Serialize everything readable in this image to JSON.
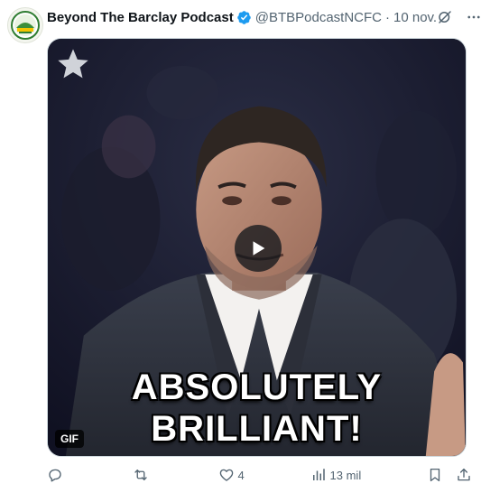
{
  "tweet": {
    "author_name": "Beyond The Barclay Podcast",
    "handle": "@BTBPodcastNCFC",
    "separator": "·",
    "date": "10 nov."
  },
  "media": {
    "caption_line1": "ABSOLUTELY",
    "caption_line2": "BRILLIANT!",
    "badge": "GIF"
  },
  "actions": {
    "replies": "",
    "reposts": "",
    "likes": "4",
    "views": "13 mil"
  },
  "icons": {
    "verified": "verified-badge-icon",
    "grok": "grok-icon",
    "more": "more-icon",
    "reply": "reply-icon",
    "repost": "repost-icon",
    "like": "heart-icon",
    "views": "views-icon",
    "bookmark": "bookmark-icon",
    "share": "share-icon"
  },
  "colors": {
    "verified": "#1d9bf0",
    "secondary_text": "#536471",
    "primary_text": "#0f1419"
  }
}
